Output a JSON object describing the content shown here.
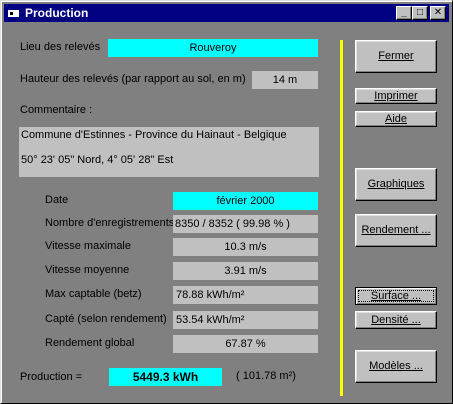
{
  "window": {
    "title": "Production"
  },
  "fields": {
    "lieu_label": "Lieu des relevés",
    "lieu_value": "Rouveroy",
    "hauteur_label": "Hauteur des relevés (par rapport au sol, en m)",
    "hauteur_value": "14 m",
    "commentaire_label": "Commentaire :",
    "comment_line1": "Commune d'Estinnes - Province du Hainaut - Belgique",
    "comment_line2": "50° 23' 05\" Nord, 4° 05' 28\" Est"
  },
  "stats": {
    "date_label": "Date",
    "date_value": "février 2000",
    "nb_label": "Nombre d'enregistrements",
    "nb_value": "8350 /  8352 ( 99.98 % )",
    "vmax_label": "Vitesse maximale",
    "vmax_value": "10.3 m/s",
    "vmoy_label": "Vitesse moyenne",
    "vmoy_value": "3.91 m/s",
    "max_label": "Max captable (betz)",
    "max_value": "78.88 kWh/m²",
    "capte_label": "Capté (selon rendement)",
    "capte_value": "53.54 kWh/m²",
    "rend_label": "Rendement global",
    "rend_value": "67.87 %"
  },
  "production": {
    "label": "Production =",
    "value": "5449.3 kWh",
    "extra": "( 101.78 m²)"
  },
  "buttons": {
    "fermer": "Fermer",
    "imprimer": "Imprimer",
    "aide": "Aide",
    "graphiques": "Graphiques",
    "rendement": "Rendement ...",
    "surface": "Surface ...",
    "densite": "Densité ...",
    "modeles": "Modèles ..."
  }
}
